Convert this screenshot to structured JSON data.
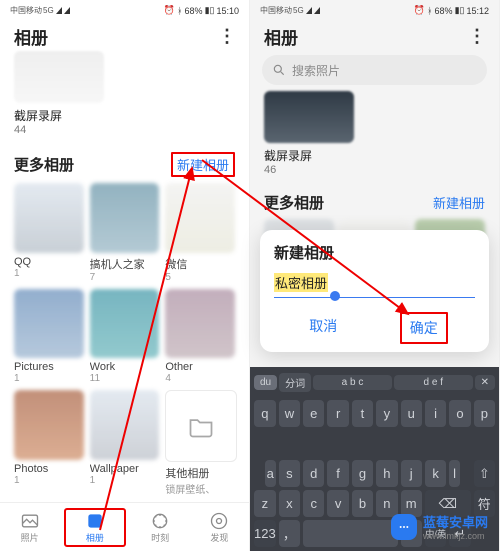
{
  "statusbar": {
    "carrier": "中国移动",
    "net": "5G",
    "battery": "68%",
    "time_left": "15:10",
    "time_right": "15:12"
  },
  "appbar": {
    "title": "相册",
    "more": "⋮"
  },
  "search": {
    "placeholder": "搜索照片",
    "icon": "search-icon"
  },
  "recent": {
    "left": {
      "name": "截屏录屏",
      "count": "44"
    },
    "right": {
      "name": "截屏录屏",
      "count": "46"
    }
  },
  "section": {
    "title": "更多相册",
    "new_album": "新建相册"
  },
  "albums": [
    {
      "name": "QQ",
      "count": "1"
    },
    {
      "name": "搞机人之家",
      "count": "7"
    },
    {
      "name": "微信",
      "count": "5"
    },
    {
      "name": "Pictures",
      "count": "1"
    },
    {
      "name": "Work",
      "count": "11"
    },
    {
      "name": "Other",
      "count": "4"
    },
    {
      "name": "Photos",
      "count": "1"
    },
    {
      "name": "Wallpaper",
      "count": "1"
    },
    {
      "name": "其他相册",
      "count": "锁屏壁纸、"
    }
  ],
  "nav": {
    "items": [
      {
        "label": "照片"
      },
      {
        "label": "相册"
      },
      {
        "label": "时刻"
      },
      {
        "label": "发现"
      }
    ],
    "active_index": 1
  },
  "dialog": {
    "title": "新建相册",
    "input_value": "私密相册",
    "cancel": "取消",
    "ok": "确定"
  },
  "keyboard": {
    "branding": "du",
    "toolbar": [
      "分词",
      "a b c",
      "d e f",
      "✕"
    ],
    "rows": [
      [
        "q",
        "w",
        "e",
        "r",
        "t",
        "y",
        "u",
        "i",
        "o",
        "p"
      ],
      [
        "a",
        "s",
        "d",
        "f",
        "g",
        "h",
        "j",
        "k",
        "l"
      ],
      [
        "⇧",
        "z",
        "x",
        "c",
        "v",
        "b",
        "n",
        "m",
        "⌫"
      ],
      [
        "符",
        "123",
        "，",
        "space",
        "。",
        "中/英",
        "↵"
      ]
    ]
  },
  "watermark": {
    "text": "蓝莓安卓网",
    "url": "www.lmkjz.com"
  },
  "colors": {
    "accent": "#2a7af0",
    "highlight": "#e00"
  }
}
